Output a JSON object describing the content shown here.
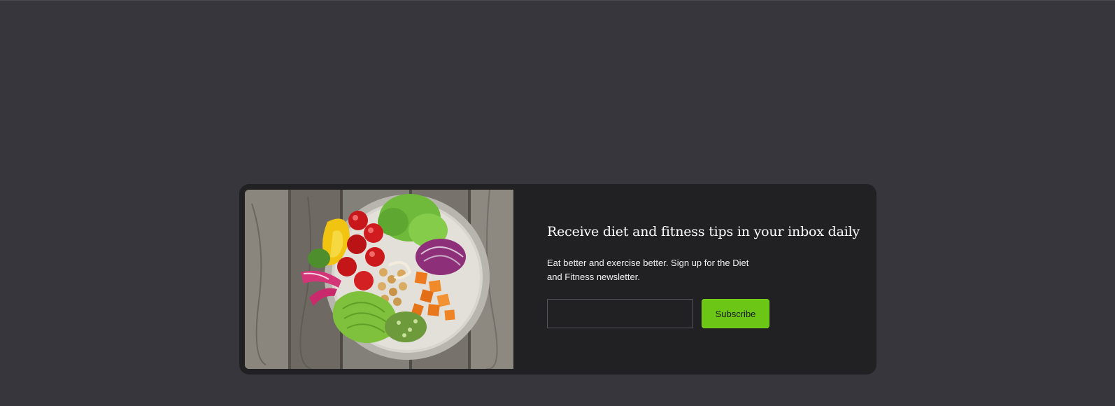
{
  "newsletter": {
    "title": "Receive diet and fitness tips in your inbox daily",
    "description": "Eat better and exercise better. Sign up for the Diet and Fitness newsletter.",
    "email_value": "",
    "email_placeholder": "",
    "subscribe_label": "Subscribe"
  },
  "colors": {
    "page_background": "#37363c",
    "card_background": "#212123",
    "accent": "#6cc616"
  },
  "image": {
    "subject": "salad bowl with vegetables on wooden table"
  }
}
